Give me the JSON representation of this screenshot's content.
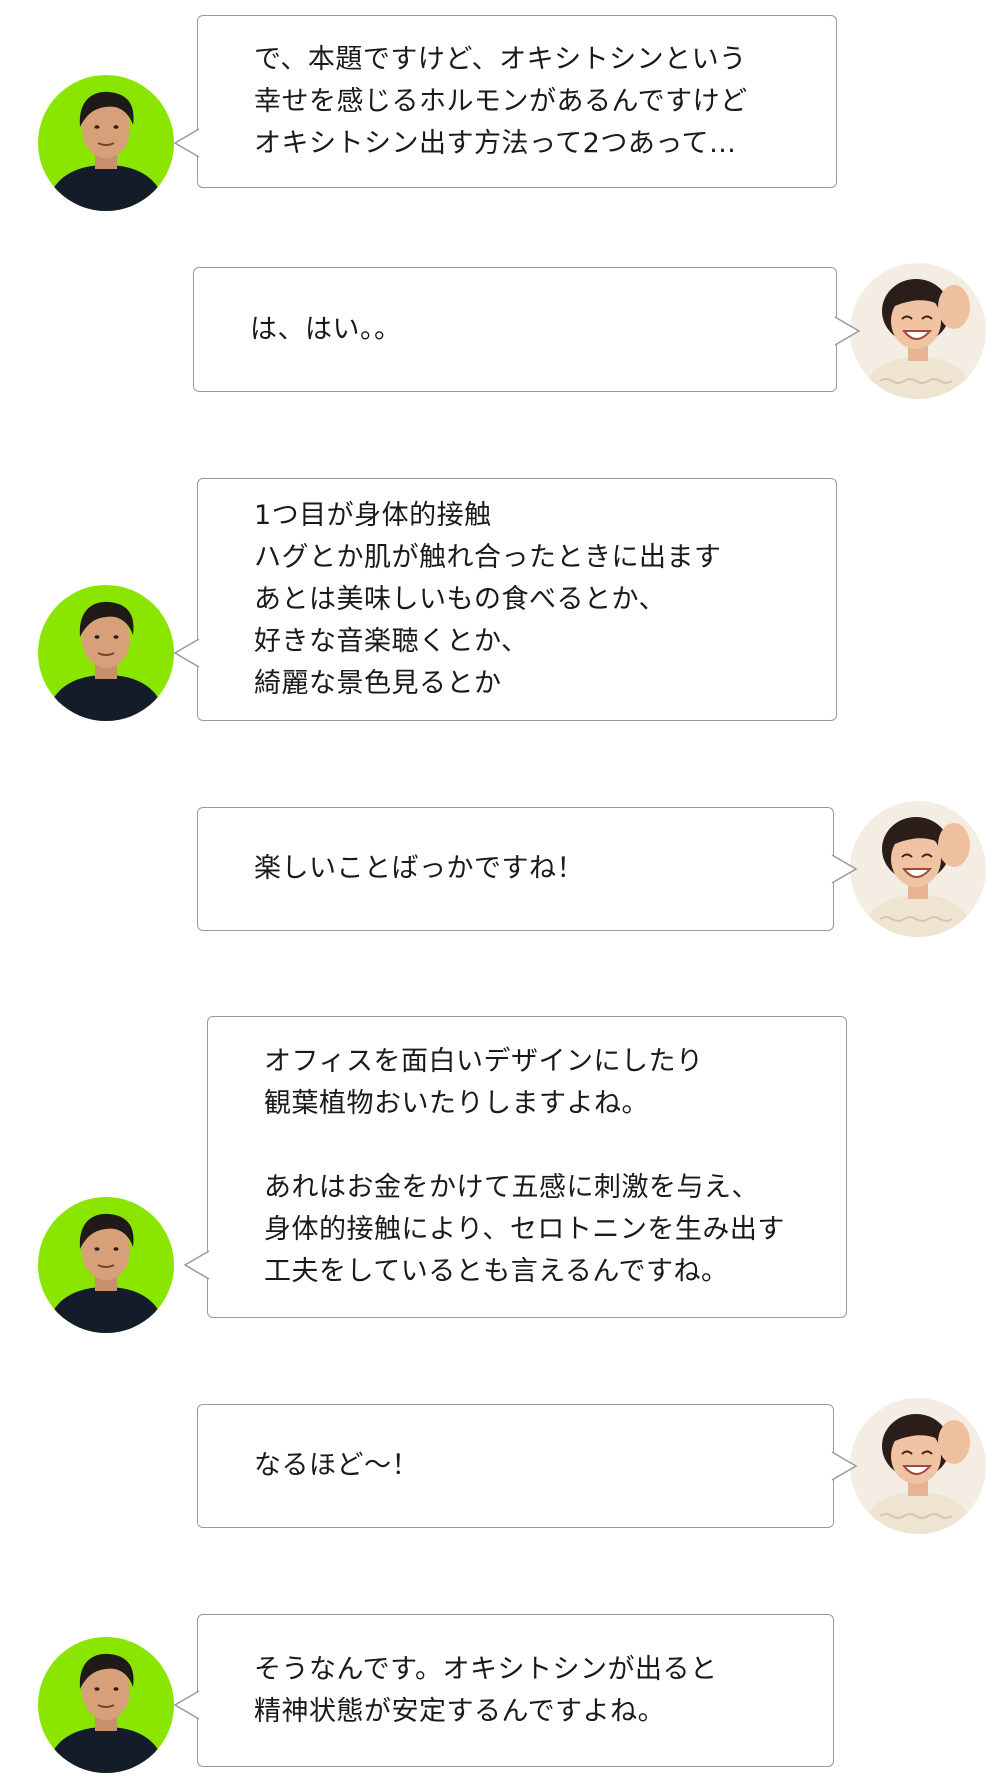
{
  "colors": {
    "man_avatar_bg": "#8ae600",
    "woman_avatar_bg": "#f4ede4",
    "bubble_border": "#9a9a9a",
    "text": "#1a1a1a"
  },
  "messages": [
    {
      "speaker": "man",
      "avatar_icon": "man-avatar-icon",
      "lines": [
        "で、本題ですけど、オキシトシンという",
        "幸せを感じるホルモンがあるんですけど",
        "オキシトシン出す方法って2つあって…"
      ]
    },
    {
      "speaker": "woman",
      "avatar_icon": "woman-avatar-icon",
      "lines": [
        "は、はい。。"
      ]
    },
    {
      "speaker": "man",
      "avatar_icon": "man-avatar-icon",
      "lines": [
        "1つ目が身体的接触",
        "ハグとか肌が触れ合ったときに出ます",
        "あとは美味しいもの食べるとか、",
        "好きな音楽聴くとか、",
        "綺麗な景色見るとか"
      ]
    },
    {
      "speaker": "woman",
      "avatar_icon": "woman-avatar-icon",
      "lines": [
        "楽しいことばっかですね！"
      ]
    },
    {
      "speaker": "man",
      "avatar_icon": "man-avatar-icon",
      "lines": [
        "オフィスを面白いデザインにしたり",
        "観葉植物おいたりしますよね。",
        "",
        "あれはお金をかけて五感に刺激を与え、",
        "身体的接触により、セロトニンを生み出す",
        "工夫をしているとも言えるんですね。"
      ]
    },
    {
      "speaker": "woman",
      "avatar_icon": "woman-avatar-icon",
      "lines": [
        "なるほど～！"
      ]
    },
    {
      "speaker": "man",
      "avatar_icon": "man-avatar-icon",
      "lines": [
        "そうなんです。オキシトシンが出ると",
        "精神状態が安定するんですよね。"
      ]
    }
  ]
}
